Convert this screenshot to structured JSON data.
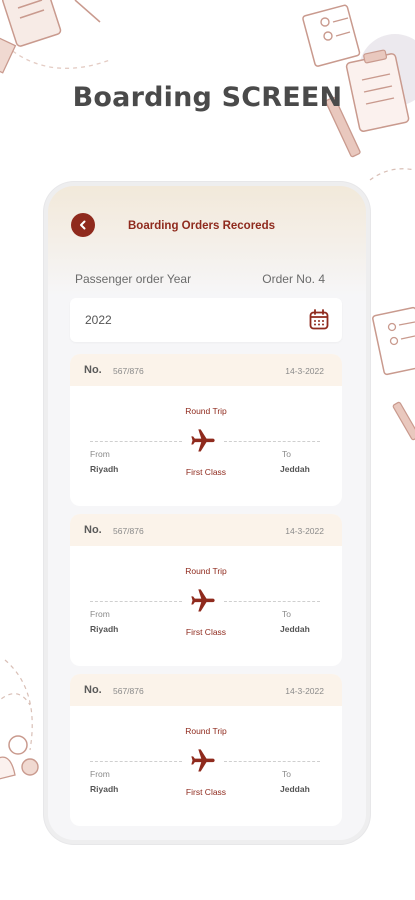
{
  "header": {
    "title": "Boarding SCREEN"
  },
  "app": {
    "title": "Boarding Orders Recoreds",
    "back_icon": "chevron-left-icon",
    "accent": "#8f2a1d"
  },
  "filter": {
    "year_label": "Passenger order Year",
    "order_label": "Order No. 4",
    "year_value": "2022",
    "calendar_icon": "calendar-icon"
  },
  "orders": [
    {
      "no_label": "No.",
      "no_value": "567/876",
      "date": "14-3-2022",
      "trip_type": "Round Trip",
      "from_label": "From",
      "from_city": "Riyadh",
      "class": "First Class",
      "to_label": "To",
      "to_city": "Jeddah"
    },
    {
      "no_label": "No.",
      "no_value": "567/876",
      "date": "14-3-2022",
      "trip_type": "Round Trip",
      "from_label": "From",
      "from_city": "Riyadh",
      "class": "First Class",
      "to_label": "To",
      "to_city": "Jeddah"
    },
    {
      "no_label": "No.",
      "no_value": "567/876",
      "date": "14-3-2022",
      "trip_type": "Round Trip",
      "from_label": "From",
      "from_city": "Riyadh",
      "class": "First Class",
      "to_label": "To",
      "to_city": "Jeddah"
    }
  ]
}
